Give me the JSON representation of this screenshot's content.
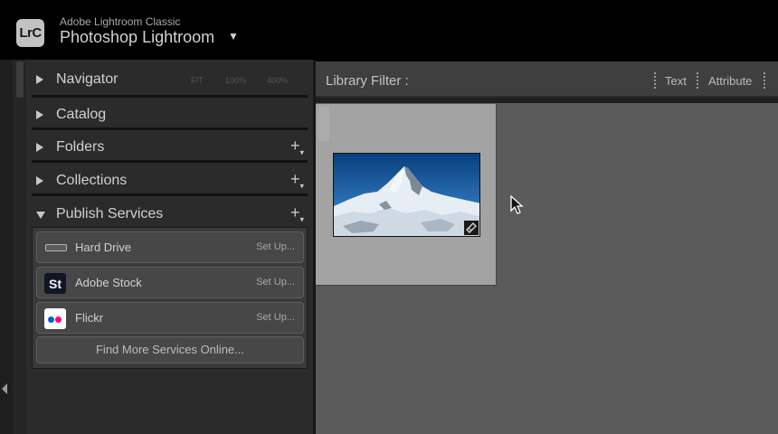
{
  "identity": {
    "logo": "LrC",
    "subtitle": "Adobe Lightroom Classic",
    "title": "Photoshop Lightroom",
    "menu_icon": "triangle-down-icon"
  },
  "left_panel": {
    "sections": [
      {
        "label": "Navigator",
        "expanded": false,
        "has_add": false,
        "zoom_options": [
          "FIT",
          "100%",
          "400%"
        ]
      },
      {
        "label": "Catalog",
        "expanded": false,
        "has_add": false
      },
      {
        "label": "Folders",
        "expanded": false,
        "has_add": true
      },
      {
        "label": "Collections",
        "expanded": false,
        "has_add": true
      },
      {
        "label": "Publish Services",
        "expanded": true,
        "has_add": true
      }
    ],
    "add_symbol": "+",
    "publish_services": [
      {
        "name": "Hard Drive",
        "action": "Set Up...",
        "icon": "hard-drive-icon"
      },
      {
        "name": "Adobe Stock",
        "action": "Set Up...",
        "icon": "adobe-stock-icon",
        "icon_text": "St"
      },
      {
        "name": "Flickr",
        "action": "Set Up...",
        "icon": "flickr-icon"
      }
    ],
    "find_more": "Find More Services Online..."
  },
  "filter_bar": {
    "title": "Library Filter :",
    "options": [
      "Text",
      "Attribute"
    ]
  },
  "grid": {
    "photos": [
      {
        "subject": "snowy mountain peak under blue sky",
        "selected": true,
        "badge_icon": "edited-badge-icon"
      }
    ]
  },
  "colors": {
    "flickr_blue": "#0063dc",
    "flickr_pink": "#ff0084",
    "stock_bg": "#0f1725"
  }
}
